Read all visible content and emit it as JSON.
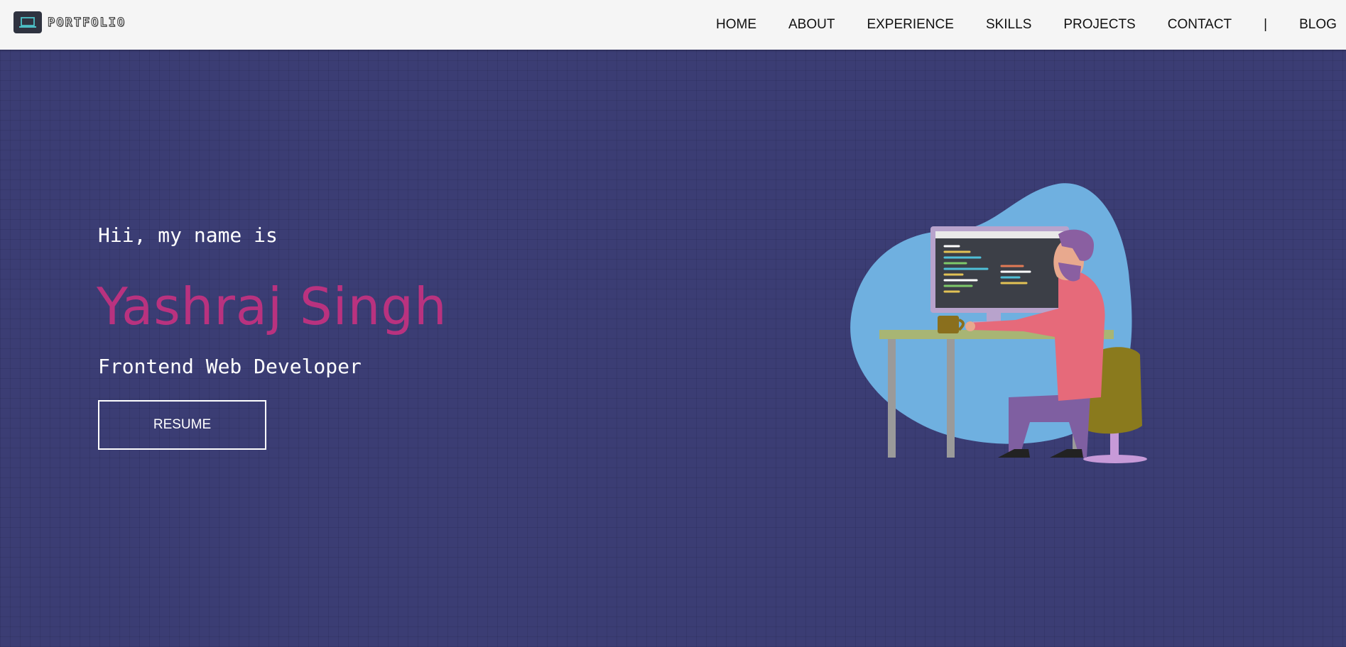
{
  "brand": {
    "logo_text": "PORTFOLIO",
    "logo_icon": "laptop-icon"
  },
  "nav": {
    "items": [
      "HOME",
      "ABOUT",
      "EXPERIENCE",
      "SKILLS",
      "PROJECTS",
      "CONTACT"
    ],
    "separator": "|",
    "blog": "BLOG"
  },
  "hero": {
    "greeting": "Hii, my name is",
    "name": "Yashraj Singh",
    "role": "Frontend Web Developer",
    "resume_label": "RESUME",
    "illustration": "developer-at-desk-illustration"
  },
  "colors": {
    "background": "#3b3d74",
    "navbar": "#f5f5f5",
    "accent_name": "#b9327f",
    "text_light": "#ffffff"
  }
}
